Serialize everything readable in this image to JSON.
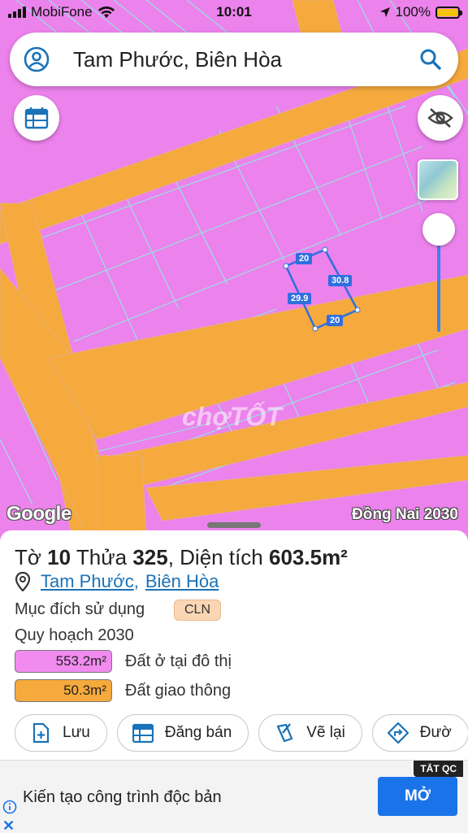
{
  "status_bar": {
    "carrier": "MobiFone",
    "time": "10:01",
    "battery": "100%"
  },
  "search": {
    "query": "Tam Phước, Biên Hòa"
  },
  "map": {
    "edge_labels": {
      "top": "20",
      "right": "30.8",
      "left": "29.9",
      "bottom": "20"
    },
    "logo_text": "Google",
    "layer_label": "Đồng Nai 2030",
    "watermark": "chợTỐT",
    "colors": {
      "residential": "#ec82ec",
      "road": "#f6a93c",
      "parcel_line": "#9fd9e3",
      "highlight": "#2f6fe0"
    }
  },
  "parcel": {
    "title_prefix": "Tờ",
    "sheet_no": "10",
    "title_lot": "Thửa",
    "lot_no": "325",
    "title_area": ", Diện tích",
    "area": "603.5m²",
    "ward": "Tam Phước",
    "separator": ",",
    "city": "Biên Hòa",
    "purpose_label": "Mục đích sử dụng",
    "purpose_code": "CLN",
    "plan_label": "Quy hoạch 2030",
    "zones": [
      {
        "area": "553.2m²",
        "label": "Đất ở tại đô thị",
        "color": "#f28bf0"
      },
      {
        "area": "50.3m²",
        "label": "Đất giao thông",
        "color": "#f6a93c"
      }
    ]
  },
  "actions": {
    "save": "Lưu",
    "sell": "Đăng bán",
    "redraw": "Vẽ lại",
    "route": "Đườ"
  },
  "ad": {
    "close_tag": "TẮT QC",
    "text": "Kiến tạo công trình độc bản",
    "cta": "MỞ"
  }
}
